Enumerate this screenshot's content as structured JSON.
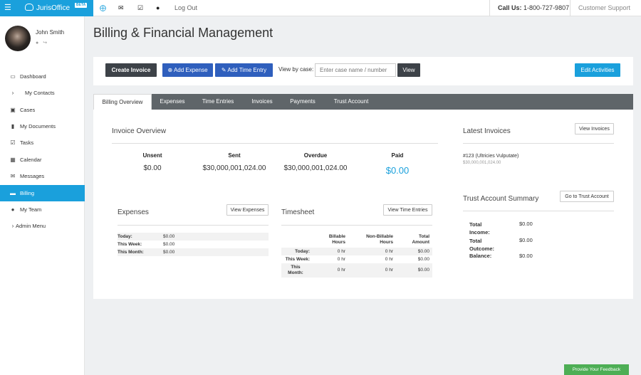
{
  "app": {
    "name": "JurisOffice",
    "beta": "BETA"
  },
  "topbar": {
    "logout": "Log Out",
    "call_label": "Call Us:",
    "call_number": "1-800-727-9807",
    "support": "Customer Support"
  },
  "user": {
    "name": "John Smith"
  },
  "sidebar": {
    "items": [
      {
        "label": "Dashboard",
        "icon": "monitor-icon"
      },
      {
        "label": "My Contacts",
        "icon": "chevron-right-icon"
      },
      {
        "label": "Cases",
        "icon": "briefcase-icon"
      },
      {
        "label": "My Documents",
        "icon": "folder-icon"
      },
      {
        "label": "Tasks",
        "icon": "checkbox-icon"
      },
      {
        "label": "Calendar",
        "icon": "calendar-icon"
      },
      {
        "label": "Messages",
        "icon": "envelope-icon"
      },
      {
        "label": "Billing",
        "icon": "credit-card-icon"
      },
      {
        "label": "My Team",
        "icon": "users-icon"
      },
      {
        "label": "Admin Menu",
        "icon": "chevron-right-icon"
      }
    ]
  },
  "page": {
    "title": "Billing & Financial Management"
  },
  "actions": {
    "create_invoice": "Create Invoice",
    "add_expense": "Add Expense",
    "add_time_entry": "Add Time Entry",
    "view_by_case": "View by case:",
    "case_placeholder": "Enter case name / number",
    "view": "View",
    "edit_activities": "Edit Activities"
  },
  "tabs": [
    "Billing Overview",
    "Expenses",
    "Time Entries",
    "Invoices",
    "Payments",
    "Trust Account"
  ],
  "invoice_overview": {
    "title": "Invoice Overview",
    "columns": [
      {
        "label": "Unsent",
        "value": "$0.00"
      },
      {
        "label": "Sent",
        "value": "$30,000,001,024.00"
      },
      {
        "label": "Overdue",
        "value": "$30,000,001,024.00"
      },
      {
        "label": "Paid",
        "value": "$0.00"
      }
    ]
  },
  "latest_invoices": {
    "title": "Latest Invoices",
    "button": "View Invoices",
    "item_title": "#123 (Ultricies Vulputate)",
    "item_amount": "$30,000,001,024.00"
  },
  "expenses": {
    "title": "Expenses",
    "button": "View Expenses",
    "rows": [
      {
        "label": "Today:",
        "value": "$0.00"
      },
      {
        "label": "This Week:",
        "value": "$0.00"
      },
      {
        "label": "This Month:",
        "value": "$0.00"
      }
    ]
  },
  "timesheet": {
    "title": "Timesheet",
    "button": "View Time Entries",
    "headers": [
      "Billable\nHours",
      "Non-Billable\nHours",
      "Total\nAmount"
    ],
    "rows": [
      {
        "label": "Today:",
        "billable": "0 hr",
        "nonbillable": "0 hr",
        "total": "$0.00"
      },
      {
        "label": "This Week:",
        "billable": "0 hr",
        "nonbillable": "0 hr",
        "total": "$0.00"
      },
      {
        "label": "This\nMonth:",
        "billable": "0 hr",
        "nonbillable": "0 hr",
        "total": "$0.00"
      }
    ]
  },
  "trust": {
    "title": "Trust Account Summary",
    "button": "Go to Trust Account",
    "rows": [
      {
        "label": "Total\nIncome:",
        "value": "$0.00"
      },
      {
        "label": "Total\nOutcome:",
        "value": "$0.00"
      },
      {
        "label": "Balance:",
        "value": "$0.00"
      }
    ]
  },
  "feedback": "Provide Your Feedback",
  "colors": {
    "accent": "#1aa0dc",
    "primary_button": "#2f5fbd",
    "dark_button": "#3d4248",
    "tab_bar": "#5f6569",
    "feedback": "#4dae55"
  }
}
